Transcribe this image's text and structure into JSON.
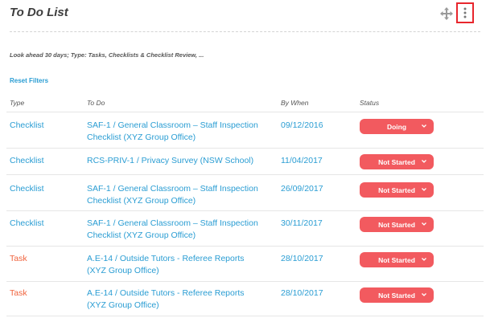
{
  "header": {
    "title": "To Do List",
    "move_icon": "move-arrows-icon",
    "menu_icon": "vertical-ellipsis-icon"
  },
  "summary": "Look ahead 30 days; Type: Tasks, Checklists & Checklist Review, ...",
  "reset_filters": "Reset Filters",
  "columns": {
    "type": "Type",
    "todo": "To Do",
    "when": "By When",
    "status": "Status"
  },
  "colors": {
    "link": "#2a9dd3",
    "task": "#f0643e",
    "status_bg": "#f25a5f",
    "highlight": "#e8262d"
  },
  "rows": [
    {
      "type": "Checklist",
      "todo": [
        "SAF-1 / General Classroom – Staff Inspection",
        "Checklist (XYZ Group Office)"
      ],
      "when": "09/12/2016",
      "status": "Doing"
    },
    {
      "type": "Checklist",
      "todo": [
        "RCS-PRIV-1 / Privacy Survey (NSW School)",
        ""
      ],
      "when": "11/04/2017",
      "status": "Not Started"
    },
    {
      "type": "Checklist",
      "todo": [
        "SAF-1 / General Classroom – Staff Inspection",
        "Checklist (XYZ Group Office)"
      ],
      "when": "26/09/2017",
      "status": "Not Started"
    },
    {
      "type": "Checklist",
      "todo": [
        "SAF-1 / General Classroom – Staff Inspection",
        "Checklist (XYZ Group Office)"
      ],
      "when": "30/11/2017",
      "status": "Not Started"
    },
    {
      "type": "Task",
      "todo": [
        "A.E-14 / Outside Tutors - Referee Reports",
        "(XYZ Group Office)"
      ],
      "when": "28/10/2017",
      "status": "Not Started"
    },
    {
      "type": "Task",
      "todo": [
        "A.E-14 / Outside Tutors - Referee Reports",
        "(XYZ Group Office)"
      ],
      "when": "28/10/2017",
      "status": "Not Started"
    }
  ]
}
